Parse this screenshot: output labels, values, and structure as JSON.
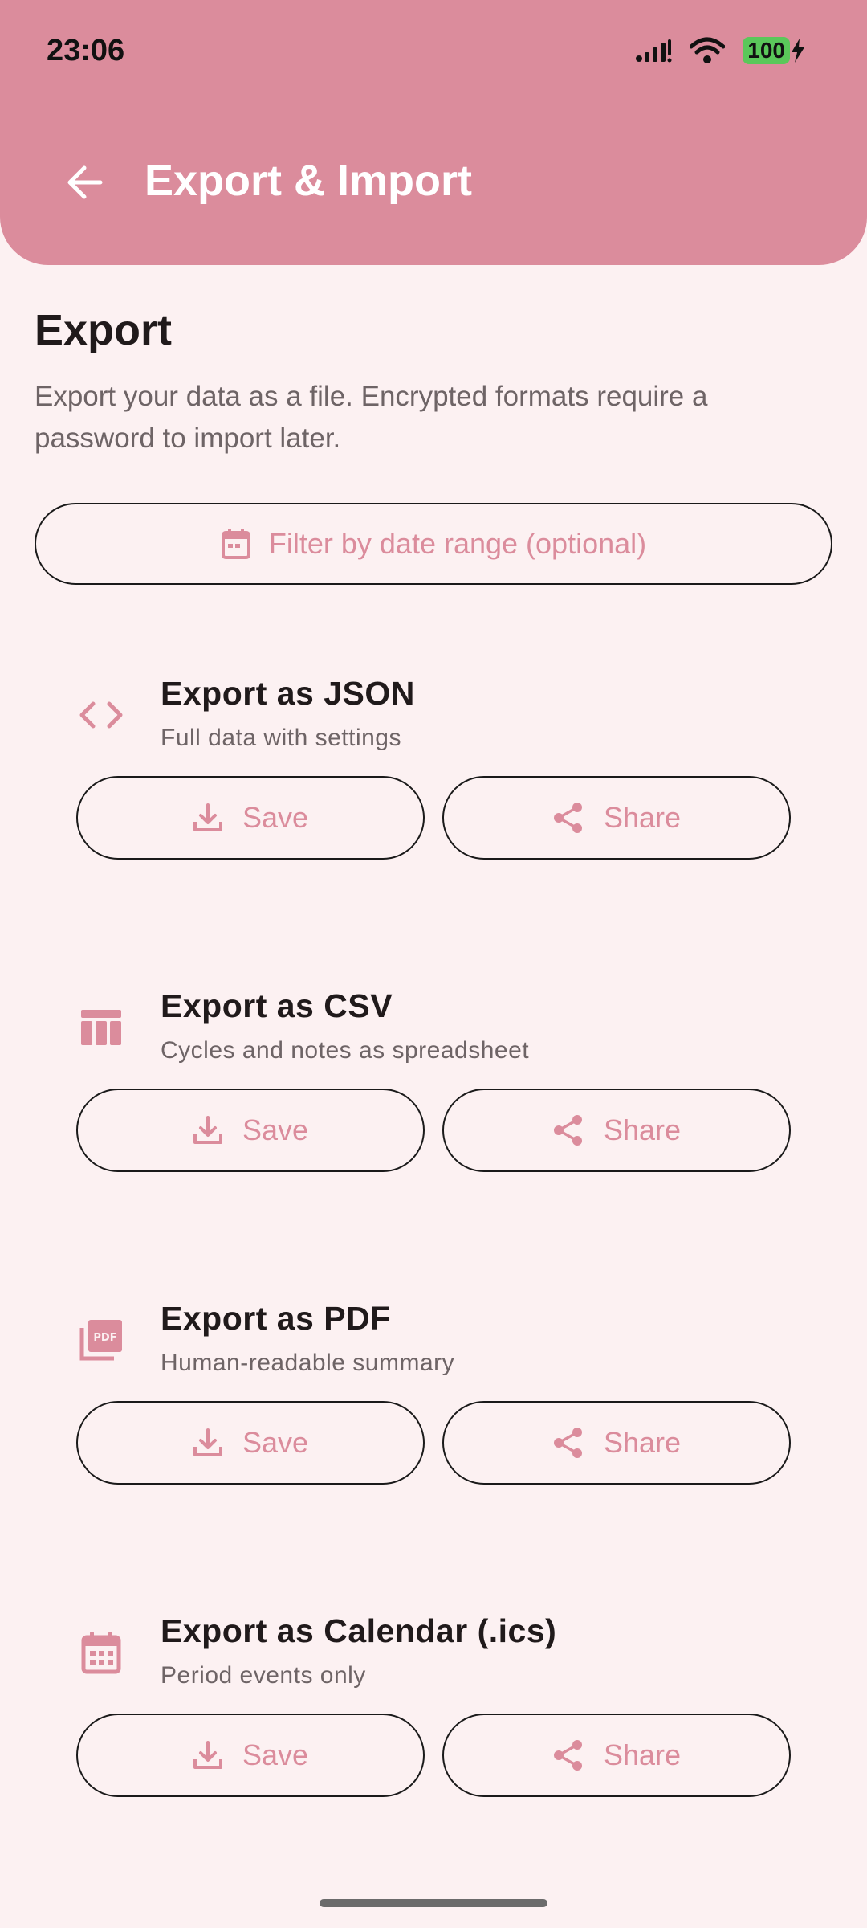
{
  "status_bar": {
    "time": "23:06",
    "battery": "100"
  },
  "app_bar": {
    "title": "Export & Import"
  },
  "export_section": {
    "title": "Export",
    "description": "Export your data as a file. Encrypted formats require a password to import later.",
    "filter_label": "Filter by date range (optional)"
  },
  "items": [
    {
      "title": "Export as JSON",
      "subtitle": "Full data with settings",
      "icon": "code-icon",
      "save_label": "Save",
      "share_label": "Share"
    },
    {
      "title": "Export as CSV",
      "subtitle": "Cycles and notes as spreadsheet",
      "icon": "table-icon",
      "save_label": "Save",
      "share_label": "Share"
    },
    {
      "title": "Export as PDF",
      "subtitle": "Human-readable summary",
      "icon": "pdf-icon",
      "save_label": "Save",
      "share_label": "Share"
    },
    {
      "title": "Export as Calendar (.ics)",
      "subtitle": "Period events only",
      "icon": "calendar-icon",
      "save_label": "Save",
      "share_label": "Share"
    }
  ],
  "colors": {
    "primary": "#DB8C9C",
    "background": "#FCF1F2",
    "text": "#201A1B",
    "muted": "#6E6466"
  }
}
